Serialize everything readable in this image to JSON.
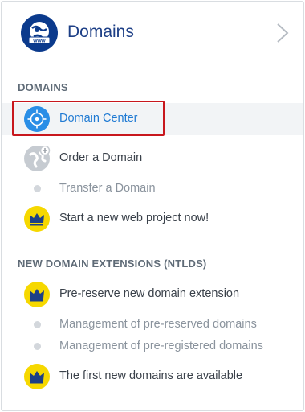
{
  "header": {
    "title": "Domains",
    "icon": "www-globe-icon"
  },
  "sections": [
    {
      "title": "DOMAINS",
      "items": [
        {
          "label": "Domain Center",
          "icon": "globe-compass-icon",
          "state": "active"
        },
        {
          "label": "Order a Domain",
          "icon": "globe-add-icon",
          "state": "normal"
        },
        {
          "label": "Transfer a Domain",
          "icon": "bullet-dot",
          "state": "muted"
        },
        {
          "label": "Start a new web project now!",
          "icon": "crown-icon",
          "state": "normal"
        }
      ]
    },
    {
      "title": "NEW DOMAIN EXTENSIONS (NTLDS)",
      "items": [
        {
          "label": "Pre-reserve new domain extension",
          "icon": "crown-icon",
          "state": "normal"
        },
        {
          "label": "Management of pre-reserved domains",
          "icon": "bullet-dot",
          "state": "muted"
        },
        {
          "label": "Management of pre-registered domains",
          "icon": "bullet-dot",
          "state": "muted"
        },
        {
          "label": "The first new domains are available",
          "icon": "crown-icon",
          "state": "normal"
        }
      ]
    }
  ],
  "colors": {
    "brand": "#0b3a8c",
    "active_link": "#1f7ad3",
    "highlight_border": "#c8171d",
    "crown_badge": "#f6d800",
    "crown": "#1d3f86"
  }
}
